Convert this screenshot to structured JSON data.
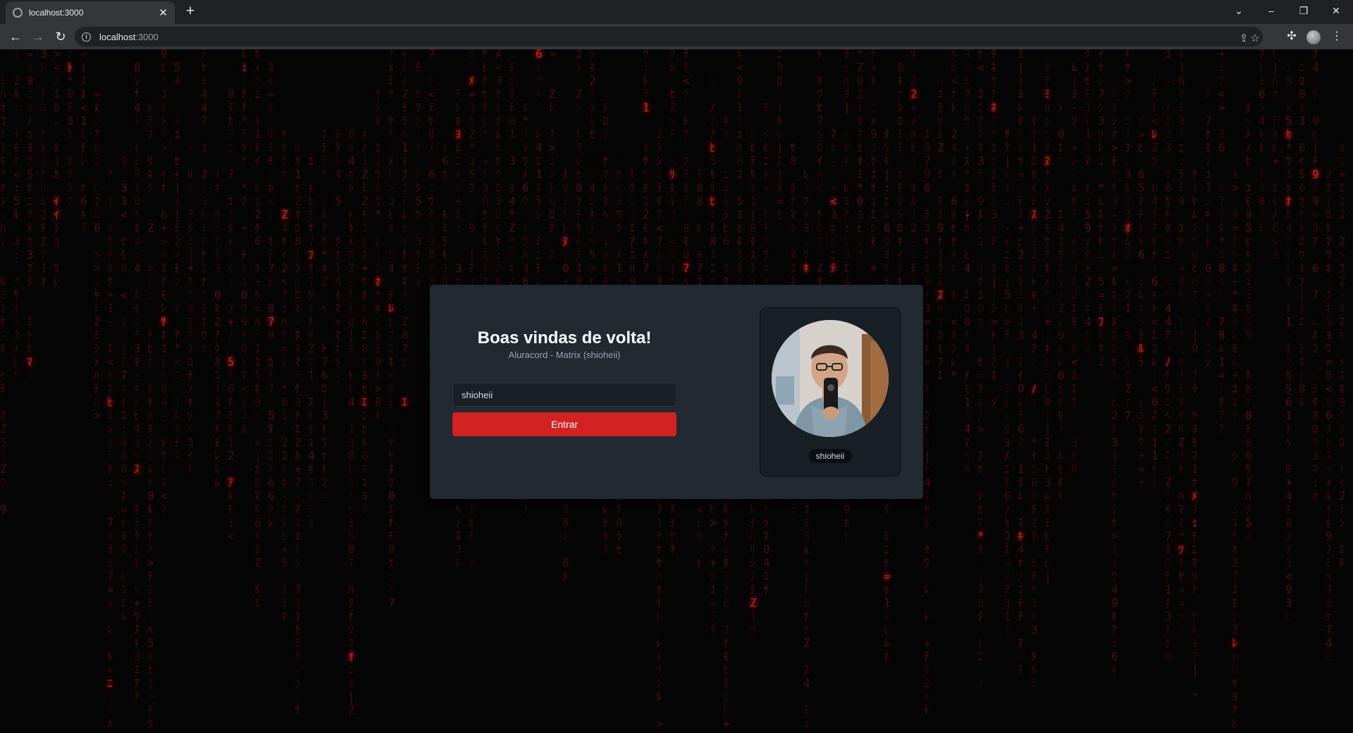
{
  "browser": {
    "tab_title": "localhost:3000",
    "new_tab_symbol": "+",
    "url_host": "localhost",
    "url_port": ":3000",
    "icons": [
      "globe-icon",
      "close-icon",
      "back-icon",
      "forward-icon",
      "reload-icon",
      "info-icon",
      "share-icon",
      "star-icon",
      "puzzle-icon",
      "menu-icon"
    ]
  },
  "login": {
    "title": "Boas vindas de volta!",
    "subtitle": "Aluracord - Matrix (shioheii)",
    "username_value": "shioheii",
    "enter_label": "Entrar"
  },
  "profile": {
    "username": "shioheii"
  },
  "colors": {
    "card_bg": "#212931",
    "button_bg": "#d32222",
    "rain_dim": "#3a0d0b",
    "rain_bright": "#e0201a"
  }
}
